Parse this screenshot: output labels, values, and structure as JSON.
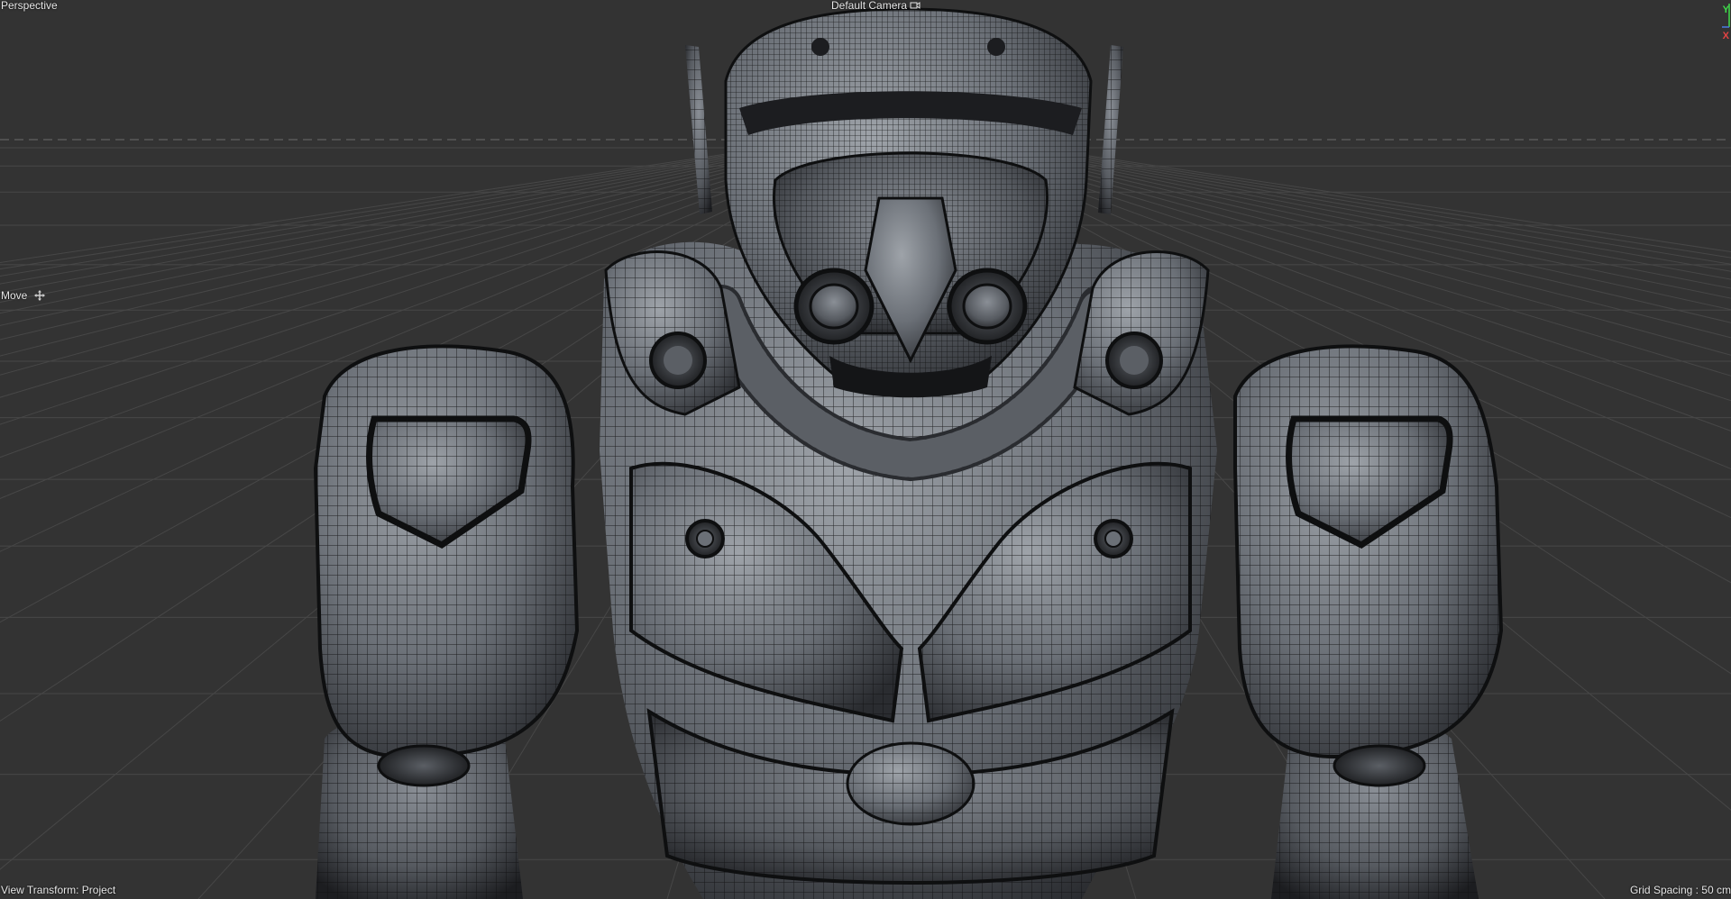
{
  "viewport": {
    "view_name": "Perspective",
    "camera_label": "Default Camera",
    "camera_icon": "camera-sync-icon",
    "tool_label": "Move",
    "tool_icon": "move-icon",
    "view_transform": "View Transform: Project",
    "grid_spacing": "Grid Spacing : 50 cm",
    "axis_labels": {
      "y": "Y",
      "x": "X"
    },
    "colors": {
      "background": "#333333",
      "grid": "#474747",
      "horizon": "#5a5a5a",
      "model_light": "#8a8e94",
      "model_dark": "#1c1d20",
      "wire": "#101112",
      "axis_y": "#3fdc4a",
      "axis_x": "#e44343"
    }
  }
}
